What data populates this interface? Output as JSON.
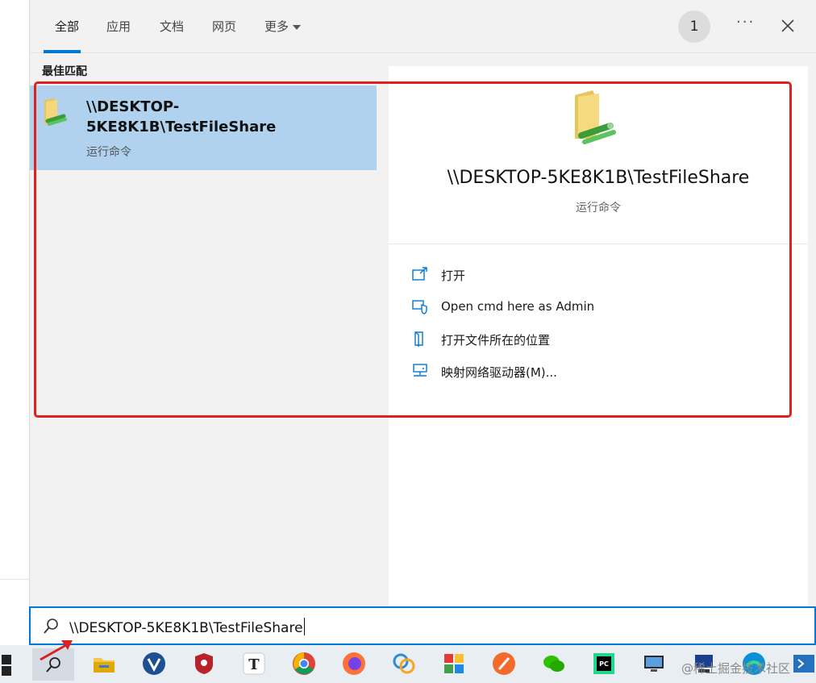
{
  "tabs": [
    {
      "label": "全部",
      "active": true
    },
    {
      "label": "应用"
    },
    {
      "label": "文档"
    },
    {
      "label": "网页"
    },
    {
      "label": "更多"
    }
  ],
  "badge_count": "1",
  "more_label": "···",
  "section_label": "最佳匹配",
  "result": {
    "title": "\\\\DESKTOP-5KE8K1B\\TestFileShare",
    "subtitle": "运行命令"
  },
  "detail": {
    "title": "\\\\DESKTOP-5KE8K1B\\TestFileShare",
    "subtitle": "运行命令",
    "actions": [
      {
        "label": "打开",
        "icon": "open-icon"
      },
      {
        "label": "Open cmd here as Admin",
        "icon": "shield-icon"
      },
      {
        "label": "打开文件所在的位置",
        "icon": "file-location-icon"
      },
      {
        "label": "映射网络驱动器(M)...",
        "icon": "network-drive-icon"
      }
    ]
  },
  "search": {
    "value": "\\\\DESKTOP-5KE8K1B\\TestFileShare"
  },
  "taskbar_icons": [
    "windows-start-icon",
    "search-icon",
    "file-explorer-icon",
    "vim-icon",
    "antivirus-icon",
    "typora-icon",
    "chrome-icon",
    "firefox-icon",
    "app-icon",
    "app-grid-icon",
    "feather-icon",
    "wechat-icon",
    "pycharm-icon",
    "monitor-icon",
    "network-icon",
    "edge-icon",
    "powershell-icon"
  ],
  "watermark": "@稀土掘金技术社区",
  "colors": {
    "accent": "#0078d7",
    "selection": "#b0d2ee",
    "annotation": "#e02020"
  }
}
